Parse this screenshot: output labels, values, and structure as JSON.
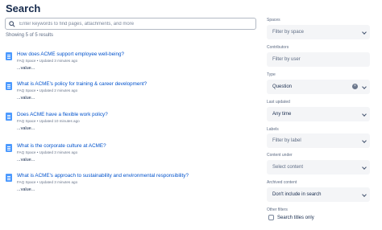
{
  "page": {
    "title": "Search"
  },
  "search": {
    "placeholder": "Enter keywords to find pages, attachments, and more",
    "value": ""
  },
  "results_count": "Showing 5 of 5 results",
  "results": [
    {
      "title": "How does ACME support employee well-being?",
      "meta": "FAQ Space  •  Updated 3 minutes ago",
      "snippet": "...value..."
    },
    {
      "title": "What is ACME's policy for training & career development?",
      "meta": "FAQ Space  •  Updated 2 minutes ago",
      "snippet": "...value..."
    },
    {
      "title": "Does ACME have a flexible work policy?",
      "meta": "FAQ Space  •  Updated 10 minutes ago",
      "snippet": "...value..."
    },
    {
      "title": "What is the corporate culture at ACME?",
      "meta": "FAQ Space  •  Updated 3 minutes ago",
      "snippet": "...value..."
    },
    {
      "title": "What is ACME's approach to sustainability and environmental responsibility?",
      "meta": "FAQ Space  •  Updated 3 minutes ago",
      "snippet": "...value..."
    }
  ],
  "filters": {
    "spaces": {
      "label": "Spaces",
      "value": "Filter by space"
    },
    "contributors": {
      "label": "Contributors",
      "value": "Filter by user"
    },
    "type": {
      "label": "Type",
      "value": "Question"
    },
    "last_updated": {
      "label": "Last updated",
      "value": "Any time"
    },
    "labels": {
      "label": "Labels",
      "value": "Filter by label"
    },
    "content_under": {
      "label": "Content under",
      "value": "Select content"
    },
    "archived": {
      "label": "Archived content",
      "value": "Don't include in search"
    },
    "other": {
      "label": "Other filters",
      "titles_only": "Search titles only",
      "titles_only_checked": false
    }
  },
  "colors": {
    "link": "#0052cc",
    "accent_icon": "#4c9aff",
    "field_bg": "#f4f5f7",
    "text": "#172b4d",
    "muted": "#5e6c84"
  }
}
